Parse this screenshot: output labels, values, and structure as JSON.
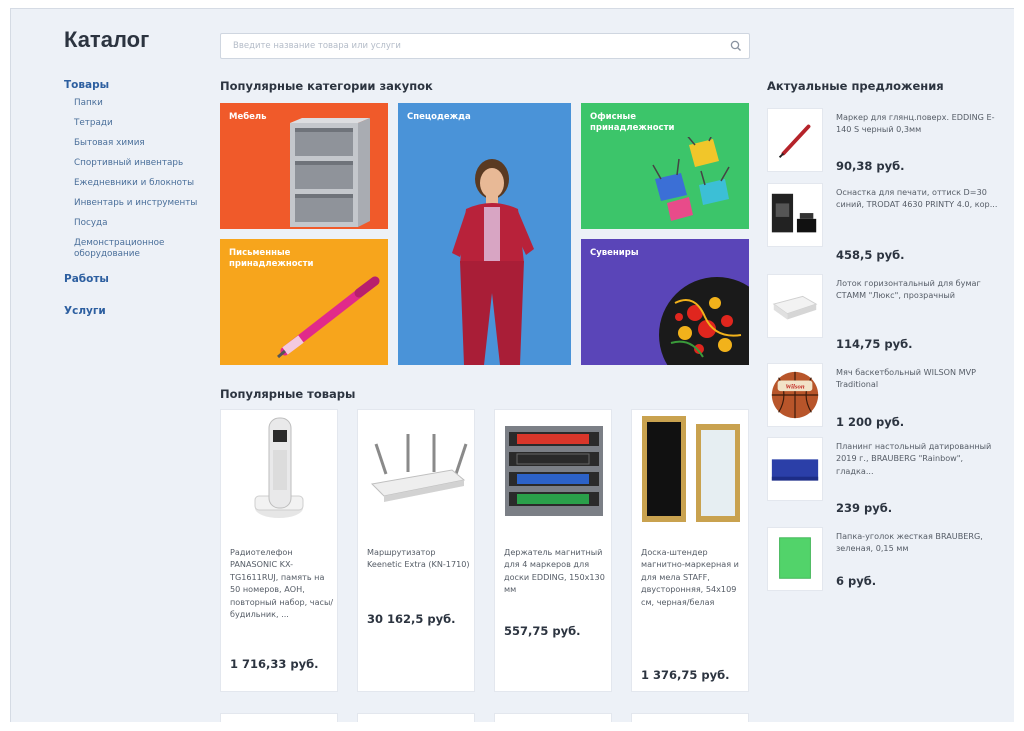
{
  "page_title": "Каталог",
  "search": {
    "placeholder": "Введите название товара или услуги"
  },
  "sidebar": {
    "goods_label": "Товары",
    "items": [
      {
        "label": "Папки"
      },
      {
        "label": "Тетради"
      },
      {
        "label": "Бытовая химия"
      },
      {
        "label": "Спортивный инвентарь"
      },
      {
        "label": "Ежедневники и блокноты"
      },
      {
        "label": "Инвентарь и инструменты"
      },
      {
        "label": "Посуда"
      },
      {
        "label": "Демонстрационное оборудование"
      }
    ],
    "works_label": "Работы",
    "services_label": "Услуги"
  },
  "categories": {
    "title": "Популярные категории закупок",
    "tiles": [
      {
        "label": "Мебель",
        "color": "#f05a2a"
      },
      {
        "label": "Спецодежда",
        "color": "#4a93d8"
      },
      {
        "label": "Офисные принадлежности",
        "color": "#3cc56a"
      },
      {
        "label": "Письменные принадлежности",
        "color": "#f7a51c"
      },
      {
        "label": "Сувениры",
        "color": "#5a45b8"
      }
    ]
  },
  "popular": {
    "title": "Популярные товары",
    "products": [
      {
        "name": "Радиотелефон PANASONIC KX-TG1611RUJ, память на 50 номеров, АОН, повторный набор, часы/будильник, ...",
        "price": "1 716,33 руб."
      },
      {
        "name": "Маршрутизатор Keenetic Extra (KN-1710)",
        "price": "30 162,5 руб."
      },
      {
        "name": "Держатель магнитный для 4 маркеров для доски EDDING, 150х130 мм",
        "price": "557,75 руб."
      },
      {
        "name": "Доска-штендер магнитно-маркерная и для мела STAFF, двусторонняя, 54х109 см, черная/белая",
        "price": "1 376,75 руб."
      }
    ]
  },
  "offers": {
    "title": "Актуальные предложения",
    "items": [
      {
        "name": "Маркер для глянц.поверх. EDDING E-140 S черный 0,3мм",
        "price": "90,38 руб."
      },
      {
        "name": "Оснастка для печати, оттиск D=30 синий, TRODAT 4630 PRINTY 4.0, кор...",
        "price": "458,5 руб."
      },
      {
        "name": "Лоток горизонтальный для бумаг СТАММ \"Люкс\", прозрачный",
        "price": "114,75 руб."
      },
      {
        "name": "Мяч баскетбольный WILSON MVP Traditional",
        "price": "1 200 руб."
      },
      {
        "name": "Планинг настольный датированный 2019 г., BRAUBERG \"Rainbow\", гладка...",
        "price": "239 руб."
      },
      {
        "name": "Папка-уголок жесткая BRAUBERG, зеленая, 0,15 мм",
        "price": "6 руб."
      }
    ]
  },
  "ball_brand": "Wilson"
}
